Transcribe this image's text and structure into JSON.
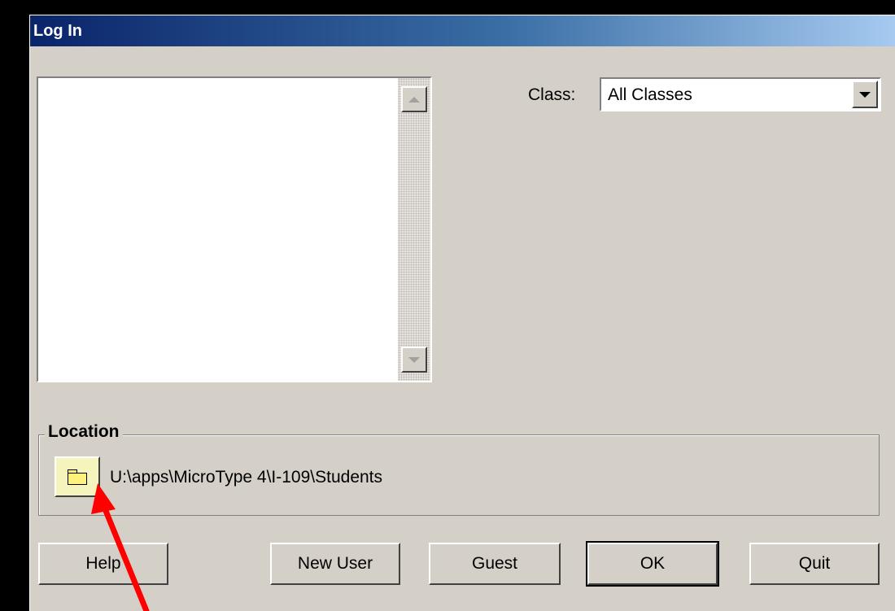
{
  "window": {
    "title": "Log In"
  },
  "class_selector": {
    "label": "Class:",
    "selected": "All Classes"
  },
  "location": {
    "legend": "Location",
    "path": "U:\\apps\\MicroType 4\\I-109\\Students"
  },
  "buttons": {
    "help": "Help",
    "new_user": "New User",
    "guest": "Guest",
    "ok": "OK",
    "quit": "Quit"
  },
  "icons": {
    "folder": "folder-icon",
    "annotation": "red-arrow"
  },
  "colors": {
    "annotation_arrow": "#ff0000",
    "titlebar_start": "#0a246a",
    "titlebar_end": "#a6caf0",
    "dialog_face": "#d4d0c8"
  }
}
